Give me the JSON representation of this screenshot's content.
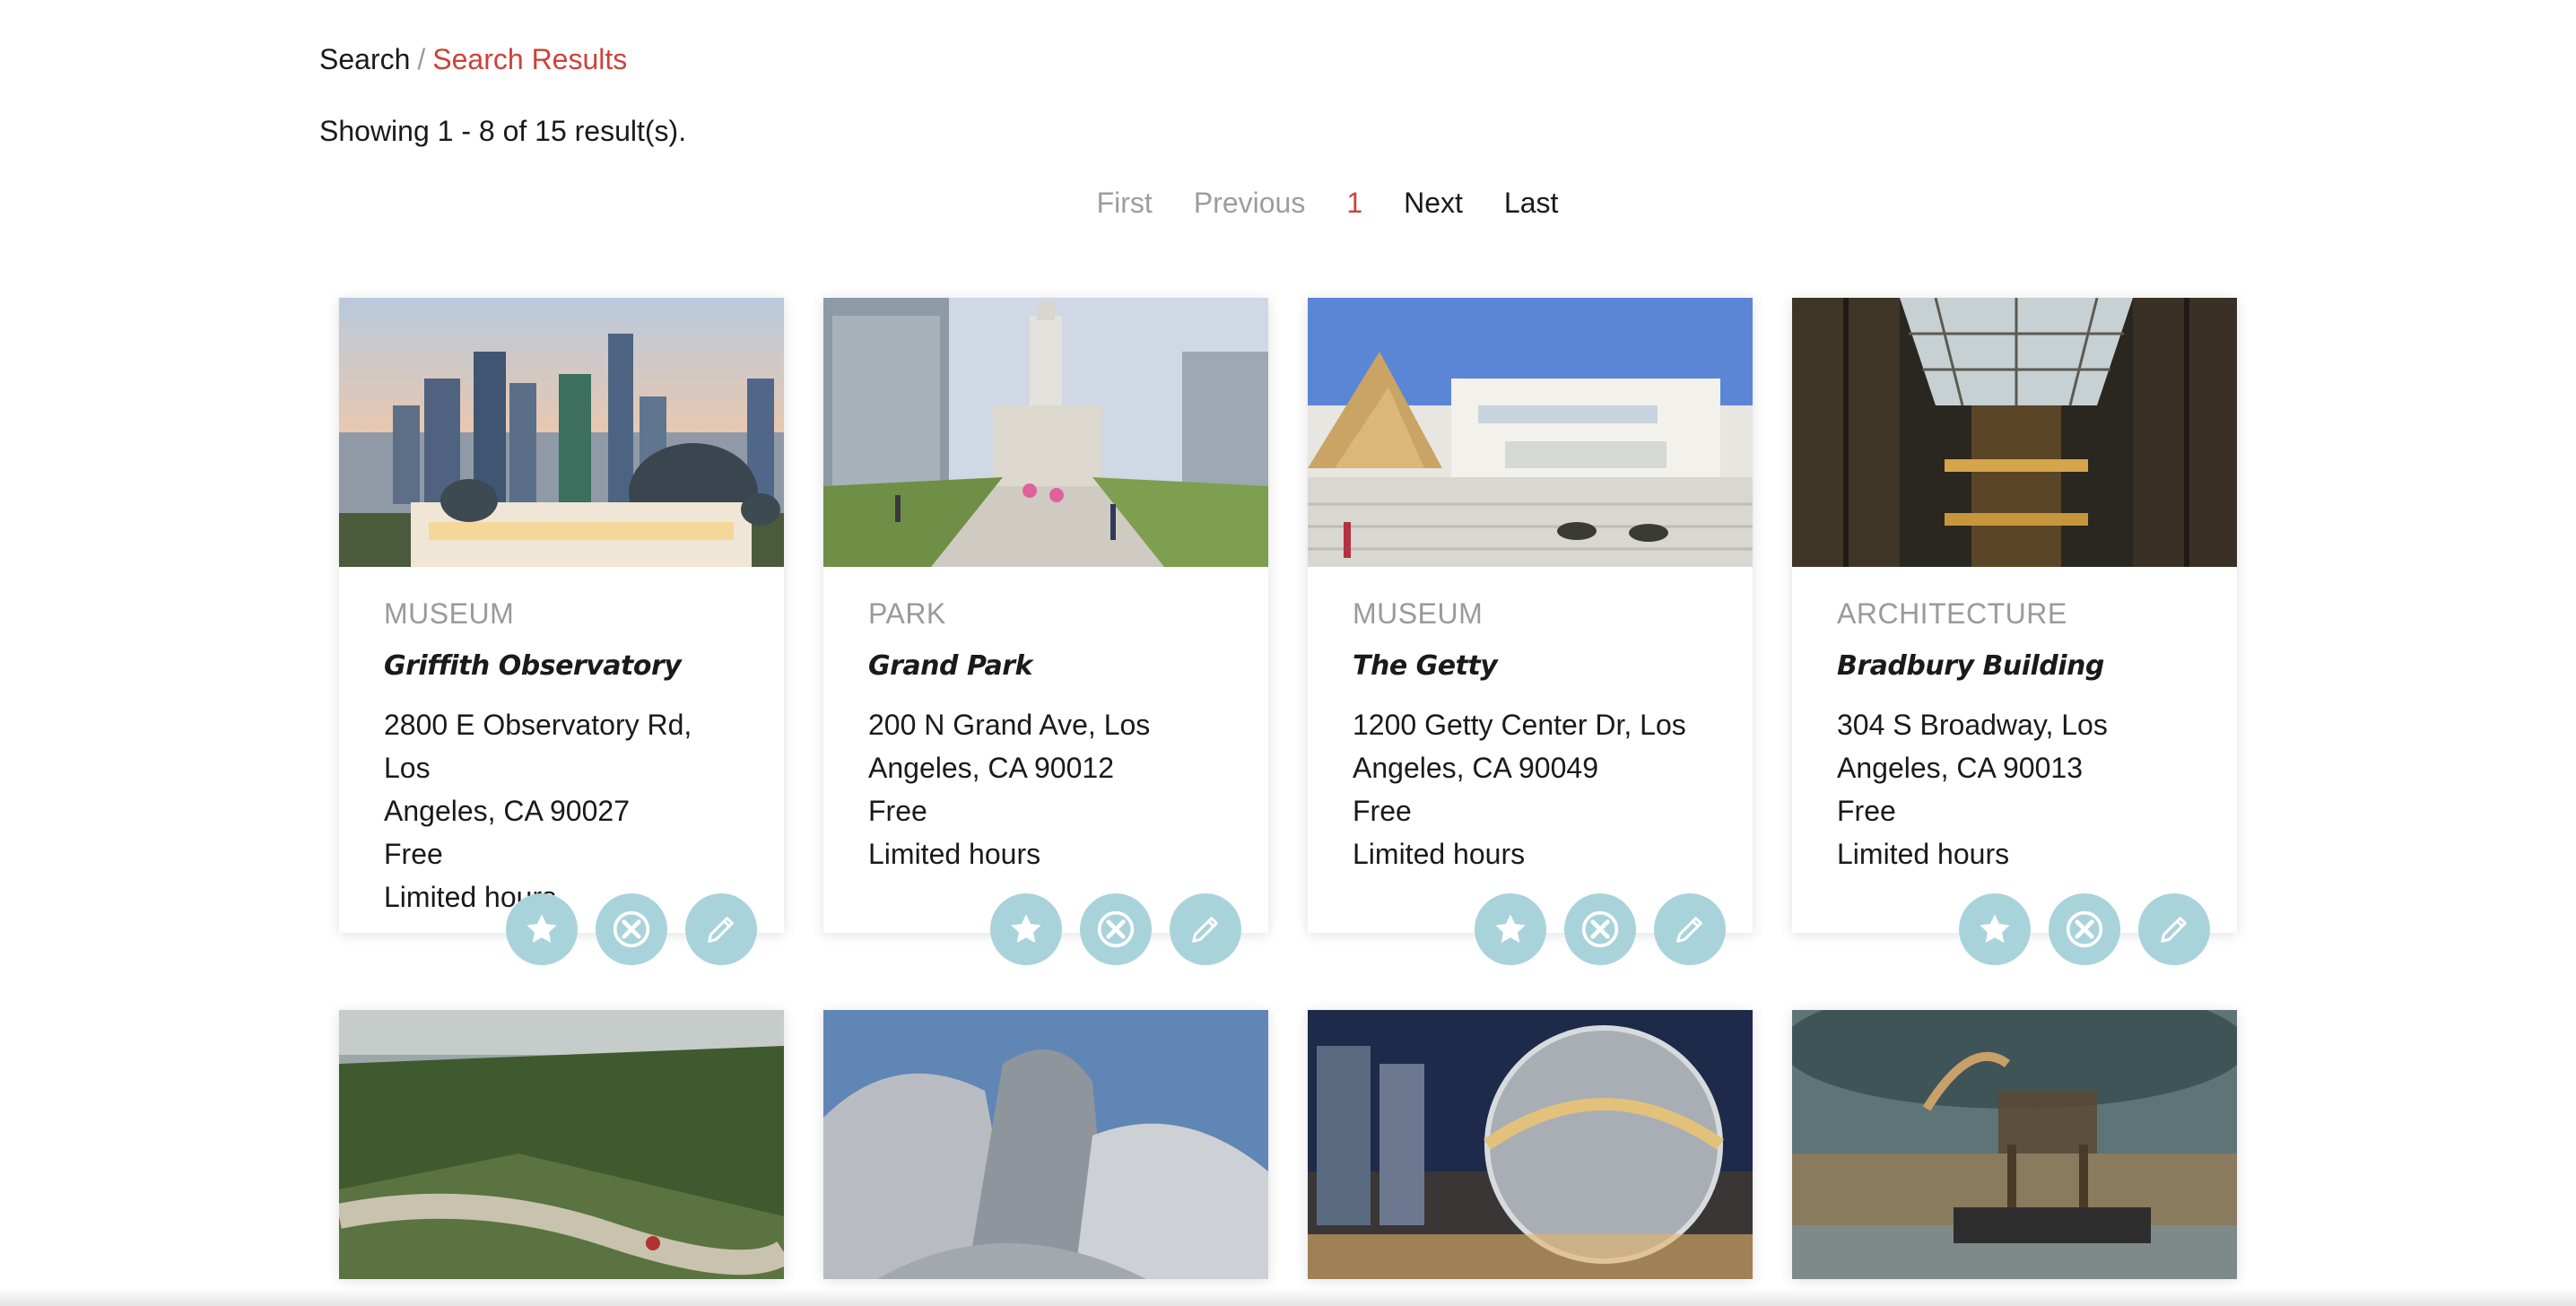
{
  "breadcrumb": {
    "root": "Search",
    "separator": "/",
    "current": "Search Results"
  },
  "results_summary": "Showing 1 - 8 of 15 result(s).",
  "pagination": {
    "first": "First",
    "previous": "Previous",
    "current_page": "1",
    "next": "Next",
    "last": "Last"
  },
  "colors": {
    "accent_red": "#d0403a",
    "action_button": "#a9d3da",
    "muted_text": "#9a9a9a"
  },
  "cards": [
    {
      "category": "MUSEUM",
      "title": "Griffith Observatory",
      "address_line1": "2800 E Observatory Rd, Los",
      "address_line2": "Angeles, CA 90027",
      "price": "Free",
      "hours": "Limited hours",
      "image": "griffith-observatory-photo"
    },
    {
      "category": "PARK",
      "title": "Grand Park",
      "address_line1": "200 N Grand Ave, Los",
      "address_line2": "Angeles, CA 90012",
      "price": "Free",
      "hours": "Limited hours",
      "image": "grand-park-photo"
    },
    {
      "category": "MUSEUM",
      "title": "The Getty",
      "address_line1": "1200 Getty Center Dr, Los",
      "address_line2": "Angeles, CA 90049",
      "price": "Free",
      "hours": "Limited hours",
      "image": "getty-center-photo"
    },
    {
      "category": "ARCHITECTURE",
      "title": "Bradbury Building",
      "address_line1": "304 S Broadway, Los",
      "address_line2": "Angeles, CA 90013",
      "price": "Free",
      "hours": "Limited hours",
      "image": "bradbury-building-photo"
    }
  ],
  "cards_row2_images": [
    "hillside-trail-photo",
    "disney-concert-hall-photo",
    "universal-globe-photo",
    "mammoth-skeleton-photo"
  ],
  "icons": {
    "favorite": "star-icon",
    "remove": "close-icon",
    "edit": "pencil-icon"
  }
}
